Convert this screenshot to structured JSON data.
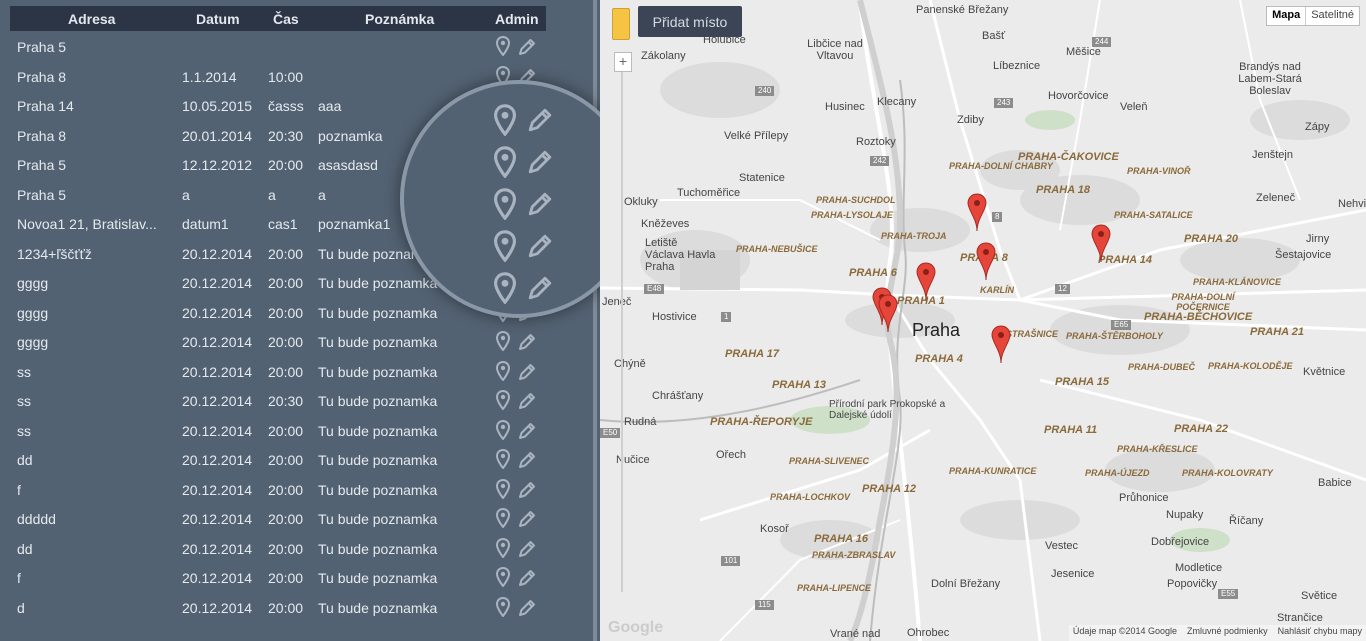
{
  "table": {
    "headers": [
      "Adresa",
      "Datum",
      "Čas",
      "Poznámka",
      "Admin"
    ],
    "rows": [
      [
        "Praha 5",
        "",
        "",
        ""
      ],
      [
        "Praha 8",
        "1.1.2014",
        "10:00",
        ""
      ],
      [
        "Praha 14",
        "10.05.2015",
        "časss",
        "aaa"
      ],
      [
        "Praha 8",
        "20.01.2014",
        "20:30",
        "poznamka"
      ],
      [
        "Praha 5",
        "12.12.2012",
        "20:00",
        "asasdasd"
      ],
      [
        "Praha 5",
        "a",
        "a",
        "a"
      ],
      [
        "Novoa1 21, Bratislav...",
        "datum1",
        "cas1",
        "poznamka1"
      ],
      [
        "1234+ľščťťž",
        "20.12.2014",
        "20:00",
        "Tu bude poznamka"
      ],
      [
        "gggg",
        "20.12.2014",
        "20:00",
        "Tu bude poznamka"
      ],
      [
        "gggg",
        "20.12.2014",
        "20:00",
        "Tu bude poznamka"
      ],
      [
        "gggg",
        "20.12.2014",
        "20:00",
        "Tu bude poznamka"
      ],
      [
        "ss",
        "20.12.2014",
        "20:00",
        "Tu bude poznamka"
      ],
      [
        "ss",
        "20.12.2014",
        "20:30",
        "Tu bude poznamka"
      ],
      [
        "ss",
        "20.12.2014",
        "20:00",
        "Tu bude poznamka"
      ],
      [
        "dd",
        "20.12.2014",
        "20:00",
        "Tu bude poznamka"
      ],
      [
        "f",
        "20.12.2014",
        "20:00",
        "Tu bude poznamka"
      ],
      [
        "ddddd",
        "20.12.2014",
        "20:00",
        "Tu bude poznamka"
      ],
      [
        "dd",
        "20.12.2014",
        "20:00",
        "Tu bude poznamka"
      ],
      [
        "f",
        "20.12.2014",
        "20:00",
        "Tu bude poznamka"
      ],
      [
        "d",
        "20.12.2014",
        "20:00",
        "Tu bude poznamka"
      ]
    ],
    "admin_icons": [
      "map-pin-icon",
      "pencil-edit-icon"
    ]
  },
  "magnifier": {
    "rows": [
      "",
      "",
      "",
      "",
      "",
      "Tu bude poznamka",
      "Tu bude poznamka"
    ]
  },
  "map": {
    "add_button": "Přidat místo",
    "type_map": "Mapa",
    "type_satellite": "Satelitné",
    "zoom_in": "+",
    "footer_data": "Údaje map ©2014 Google",
    "footer_terms": "Zmluvné podmienky",
    "footer_report": "Nahlásiť chybu mapy",
    "logo": "Google",
    "main_city": "Praha",
    "places": [
      "Panenské Břežany",
      "Bašť",
      "Holubice",
      "Libčice nad Vltavou",
      "Líbeznice",
      "Měšice",
      "Zákolany",
      "Brandýs nad Labem-Stará Boleslav",
      "Husinec",
      "Klecany",
      "Hovorčovice",
      "Veleň",
      "Zdiby",
      "Velké Přílepy",
      "Roztoky",
      "Jenštejn",
      "Zápy",
      "Statenice",
      "Tuchoměřice",
      "Zeleneč",
      "Kněževes",
      "Letiště Václava Havla Praha",
      "Nehvizdy",
      "Jirny",
      "Šestajovice",
      "Hostivice",
      "Chýně",
      "Chrášťany",
      "Rudná",
      "Nučice",
      "Ořech",
      "Kosoř",
      "Praha",
      "Květnice",
      "Babice",
      "Průhonice",
      "Nupaky",
      "Říčany",
      "Vestec",
      "Dobřejovice",
      "Jesenice",
      "Modletice",
      "Popovičky",
      "Dolní Břežany",
      "Vrané nad",
      "Ohrobec",
      "Světice",
      "Strančice",
      "Přírodní park Prokopské a Dalejské údolí",
      "Okluky",
      "Jeneč"
    ],
    "districts": [
      "PRAHA-ČAKOVICE",
      "PRAHA-DOLNÍ CHABRY",
      "PRAHA-VINOŘ",
      "PRAHA 18",
      "PRAHA-SUCHDOL",
      "PRAHA-LYSOLAJE",
      "PRAHA-SATALICE",
      "PRAHA 20",
      "PRAHA-TROJA",
      "PRAHA-NEBUŠICE",
      "PRAHA 8",
      "PRAHA 14",
      "PRAHA 6",
      "KARLÍN",
      "PRAHA 1",
      "PRAHA-KLÁNOVICE",
      "PRAHA-DOLNÍ POČERNICE",
      "PRAHA-BĚCHOVICE",
      "PRAHA 17",
      "PRAHA 4",
      "STRAŠNICE",
      "PRAHA-ŠTĚRBOHOLY",
      "PRAHA 21",
      "PRAHA 13",
      "PRAHA 15",
      "PRAHA-DUBEČ",
      "PRAHA-KOLODĚJE",
      "PRAHA-ŘEPORYJE",
      "PRAHA 11",
      "PRAHA 22",
      "PRAHA-KŘESLICE",
      "PRAHA-SLIVENEC",
      "PRAHA-KUNRATICE",
      "PRAHA-ÚJEZD",
      "PRAHA-KOLOVRATY",
      "PRAHA-LOCHKOV",
      "PRAHA 12",
      "PRAHA 16",
      "PRAHA-ZBRASLAV",
      "PRAHA-LIPENCE"
    ],
    "road_shields": [
      "244",
      "240",
      "243",
      "242",
      "8",
      "E48",
      "1",
      "12",
      "E65",
      "E50",
      "101",
      "115",
      "E55"
    ]
  }
}
